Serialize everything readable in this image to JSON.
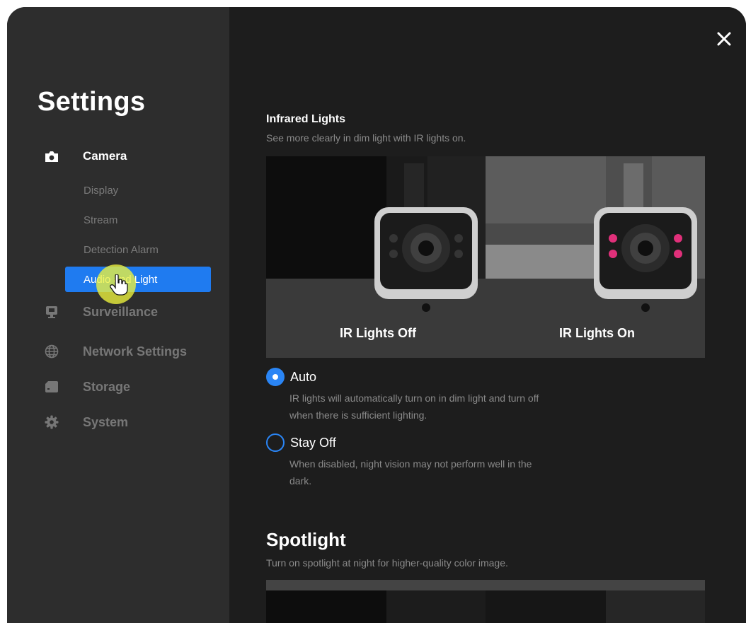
{
  "sidebar": {
    "title": "Settings",
    "groups": [
      {
        "label": "Camera",
        "icon": "camera-icon",
        "active": true
      },
      {
        "label": "Surveillance",
        "icon": "monitor-icon"
      },
      {
        "label": "Network Settings",
        "icon": "globe-icon"
      },
      {
        "label": "Storage",
        "icon": "storage-icon"
      },
      {
        "label": "System",
        "icon": "gear-icon"
      }
    ],
    "camera_items": [
      {
        "label": "Display"
      },
      {
        "label": "Stream"
      },
      {
        "label": "Detection Alarm"
      },
      {
        "label": "Audio and Light",
        "active": true
      }
    ]
  },
  "main": {
    "close_icon": "close-icon",
    "infrared": {
      "title": "Infrared Lights",
      "description": "See more clearly in dim light with IR lights on.",
      "off_caption": "IR Lights Off",
      "on_caption": "IR Lights On",
      "options": [
        {
          "label": "Auto",
          "selected": true,
          "help": "IR lights will automatically turn on in dim light and turn off when there is sufficient lighting."
        },
        {
          "label": "Stay Off",
          "selected": false,
          "help": "When disabled, night vision may not perform well in the dark."
        }
      ]
    },
    "spotlight": {
      "title": "Spotlight",
      "description": "Turn on spotlight at night for higher-quality color image."
    }
  },
  "colors": {
    "accent": "#1f7bf0",
    "sidebar_bg": "#2d2d2d",
    "main_bg": "#1d1d1d",
    "ir_led": "#e0307a"
  }
}
